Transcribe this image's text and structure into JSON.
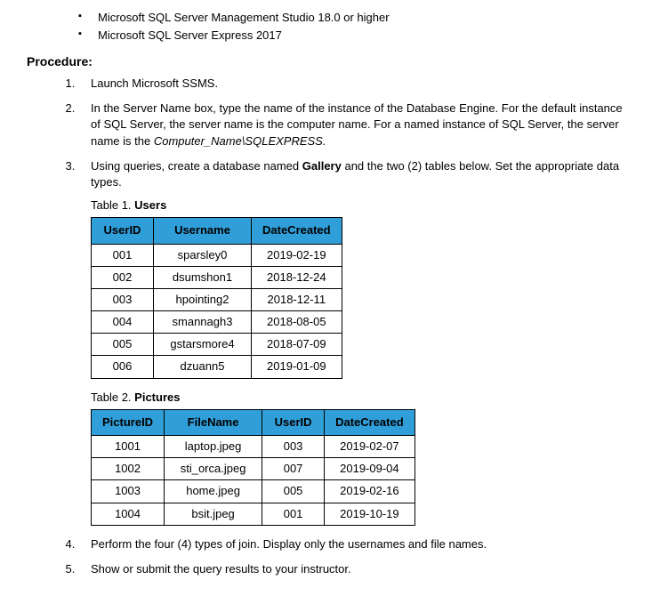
{
  "requirements": [
    "Microsoft SQL Server Management Studio 18.0 or higher",
    "Microsoft SQL Server Express 2017"
  ],
  "procedure_heading": "Procedure:",
  "steps": {
    "s1": "Launch Microsoft SSMS.",
    "s2_part1": "In the Server Name box, type the name of the instance of the Database Engine. For the default instance of SQL Server, the server name is the computer name. For a named instance of SQL Server, the server name is the ",
    "s2_italic": "Computer_Name\\SQLEXPRESS.",
    "s3_part1": "Using queries, create a database named ",
    "s3_bold": "Gallery",
    "s3_part2": " and the two (2) tables below. Set the appropriate data types.",
    "table1_caption_prefix": "Table 1. ",
    "table1_caption_bold": "Users",
    "table2_caption_prefix": "Table 2. ",
    "table2_caption_bold": "Pictures",
    "s4": "Perform the four (4) types of join. Display only the usernames and file names.",
    "s5": "Show or submit the query results to your instructor."
  },
  "table_users": {
    "headers": [
      "UserID",
      "Username",
      "DateCreated"
    ],
    "rows": [
      [
        "001",
        "sparsley0",
        "2019-02-19"
      ],
      [
        "002",
        "dsumshon1",
        "2018-12-24"
      ],
      [
        "003",
        "hpointing2",
        "2018-12-11"
      ],
      [
        "004",
        "smannagh3",
        "2018-08-05"
      ],
      [
        "005",
        "gstarsmore4",
        "2018-07-09"
      ],
      [
        "006",
        "dzuann5",
        "2019-01-09"
      ]
    ]
  },
  "table_pictures": {
    "headers": [
      "PictureID",
      "FileName",
      "UserID",
      "DateCreated"
    ],
    "rows": [
      [
        "1001",
        "laptop.jpeg",
        "003",
        "2019-02-07"
      ],
      [
        "1002",
        "sti_orca.jpeg",
        "007",
        "2019-09-04"
      ],
      [
        "1003",
        "home.jpeg",
        "005",
        "2019-02-16"
      ],
      [
        "1004",
        "bsit.jpeg",
        "001",
        "2019-10-19"
      ]
    ]
  }
}
